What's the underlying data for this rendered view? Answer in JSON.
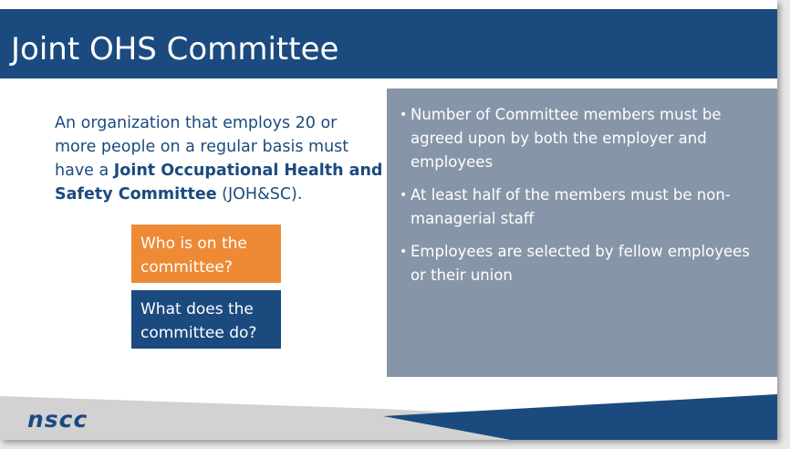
{
  "slide": {
    "title": "Joint OHS Committee",
    "intro": {
      "lead": "An organization that employs 20 or more people on a regular basis must have a ",
      "emphasis": "Joint Occupational Health and Safety Committee",
      "tail": " (JOH&SC)."
    },
    "buttons": {
      "who": "Who is on the committee?",
      "what": "What does the committee do?"
    },
    "bullets": [
      "Number of Committee members must be agreed upon by both the employer and employees",
      "At least half of the members must be non-managerial staff",
      "Employees are selected by fellow employees or their union"
    ],
    "bullet_glyph": "•",
    "logo_text": "nscc"
  },
  "colors": {
    "brand_blue": "#1b4a7e",
    "accent_orange": "#ee8a36",
    "panel_gray": "#8696a8",
    "footer_gray": "#d2d2d2"
  }
}
